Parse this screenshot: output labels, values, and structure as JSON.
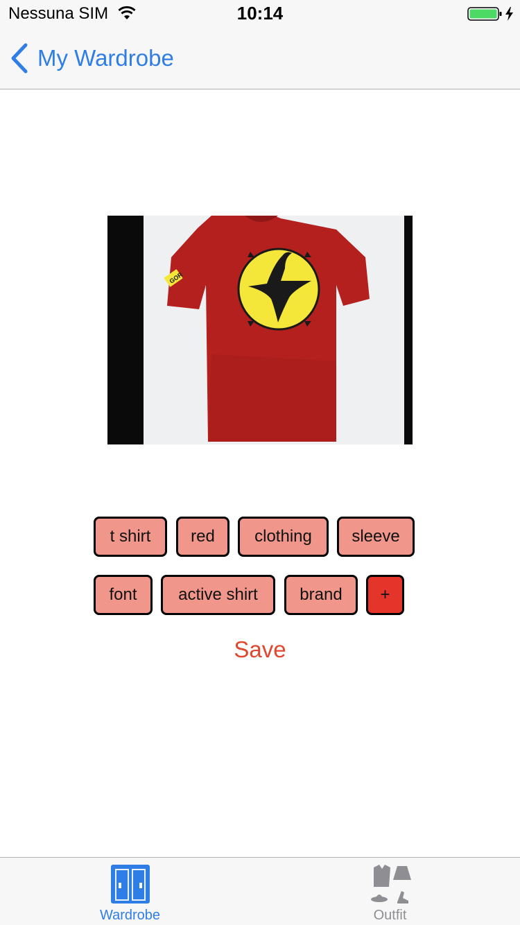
{
  "status_bar": {
    "carrier": "Nessuna SIM",
    "time": "10:14",
    "battery_color": "#4cd964"
  },
  "nav": {
    "back_label": "My Wardrobe",
    "tint_color": "#2f7ee6"
  },
  "photo": {
    "description_icon": "red-tshirt-with-yellow-phoenix-emblem",
    "sleeve_text": "GOR"
  },
  "tags": [
    {
      "label": "t shirt"
    },
    {
      "label": "red"
    },
    {
      "label": "clothing"
    },
    {
      "label": "sleeve"
    },
    {
      "label": "font"
    },
    {
      "label": "active shirt"
    },
    {
      "label": "brand"
    },
    {
      "label": "+"
    }
  ],
  "tag_colors": {
    "tag_fill": "#f0968a",
    "add_fill": "#e5352b"
  },
  "save_label": "Save",
  "save_color": "#e0472e",
  "tab_bar": {
    "tabs": [
      {
        "label": "Wardrobe",
        "icon": "wardrobe-icon",
        "selected": true
      },
      {
        "label": "Outfit",
        "icon": "outfit-icon",
        "selected": false
      }
    ],
    "selected_color": "#2f7ee6",
    "unselected_color": "#8e8e93"
  }
}
